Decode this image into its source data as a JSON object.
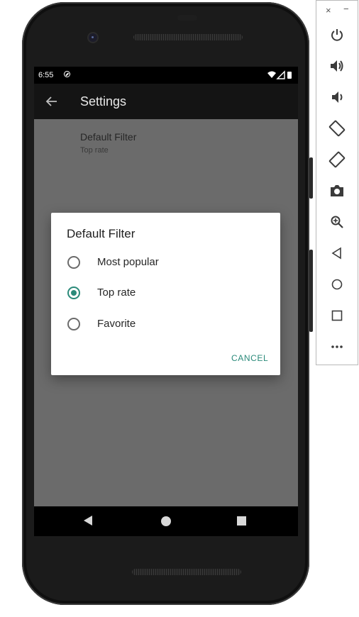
{
  "status_bar": {
    "time": "6:55"
  },
  "app_bar": {
    "title": "Settings"
  },
  "preference": {
    "title": "Default Filter",
    "summary": "Top rate"
  },
  "dialog": {
    "title": "Default Filter",
    "options": [
      {
        "label": "Most popular",
        "checked": false
      },
      {
        "label": "Top rate",
        "checked": true
      },
      {
        "label": "Favorite",
        "checked": false
      }
    ],
    "cancel_label": "CANCEL",
    "accent_color": "#2b8a7a"
  },
  "navigation_bar": {
    "buttons": [
      "back-icon",
      "home-icon",
      "recents-icon"
    ]
  },
  "emulator_toolbar": {
    "window_controls": {
      "close": "×",
      "minimize": "−"
    },
    "tools": [
      "power-icon",
      "volume-up-icon",
      "volume-down-icon",
      "rotate-left-icon",
      "rotate-right-icon",
      "screenshot-icon",
      "zoom-icon",
      "back-icon",
      "home-icon",
      "overview-icon",
      "more-icon"
    ]
  }
}
